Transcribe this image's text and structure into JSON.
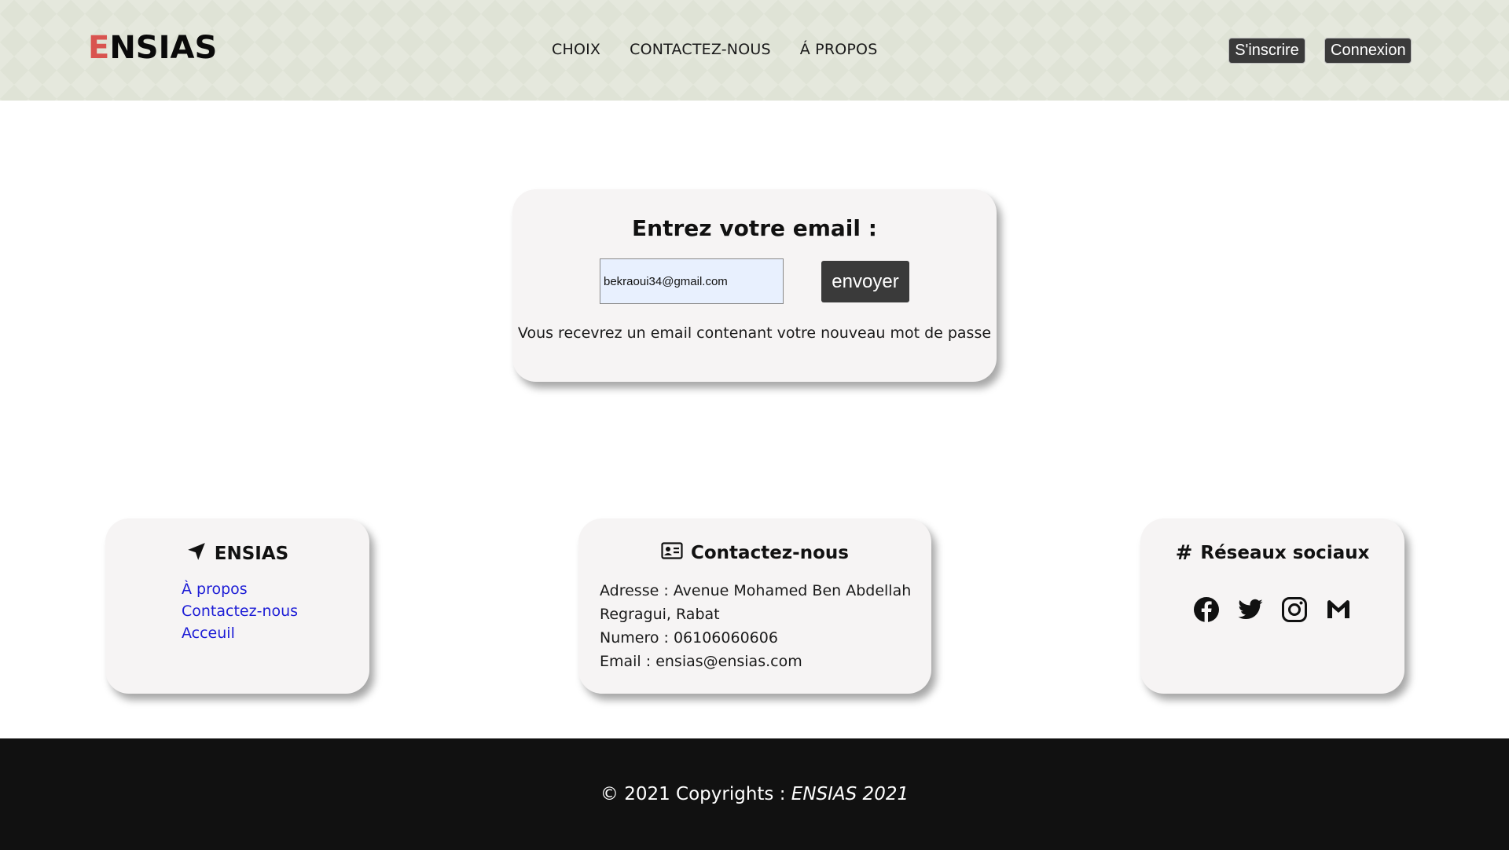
{
  "header": {
    "logo_first": "E",
    "logo_rest": "NSIAS",
    "nav": [
      "CHOIX",
      "CONTACTEZ-NOUS",
      "Á PROPOS"
    ],
    "signup_label": "S'inscrire",
    "login_label": "Connexion"
  },
  "email_form": {
    "title": "Entrez votre email :",
    "email_value": "bekraoui34@gmail.com",
    "send_label": "envoyer",
    "note": "Vous recevrez un email contenant votre nouveau mot de passe"
  },
  "footer_cards": {
    "ensias": {
      "title": "ENSIAS",
      "links": [
        "À propos",
        "Contactez-nous",
        "Acceuil"
      ]
    },
    "contact": {
      "title": "Contactez-nous",
      "lines": [
        "Adresse : Avenue Mohamed Ben Abdellah",
        "Regragui, Rabat",
        "Numero : 06106060606",
        "Email : ensias@ensias.com"
      ]
    },
    "social": {
      "title": "Réseaux sociaux",
      "icons": [
        "facebook-icon",
        "twitter-icon",
        "instagram-icon",
        "gmail-icon"
      ]
    }
  },
  "bottom": {
    "copyright_prefix": "© 2021 Copyrights : ",
    "copyright_brand": "ENSIAS 2021"
  },
  "colors": {
    "logo_accent": "#d9534f",
    "link": "#1d1dd6",
    "button_dark": "#3a3a3a",
    "bottom_bar": "#111111"
  }
}
